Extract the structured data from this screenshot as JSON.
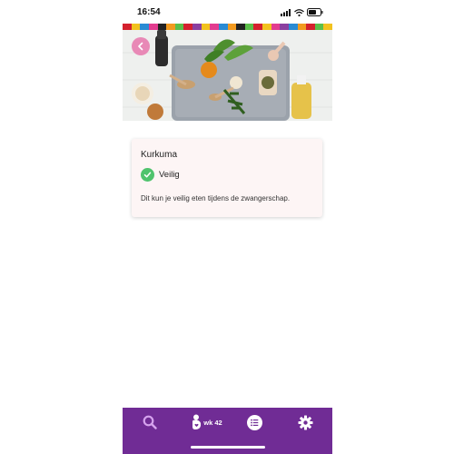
{
  "status_bar": {
    "time": "16:54"
  },
  "colors": {
    "brand_purple": "#702c95",
    "back_button": "#e889b6",
    "safe_green": "#4fc36d",
    "card_background": "#fdf5f5",
    "stripe": [
      "#d4212e",
      "#f2c21f",
      "#2a8bd4",
      "#e23c8f",
      "#222222",
      "#f29a1f",
      "#5bbf4a",
      "#d4212e",
      "#8b3fa0",
      "#f2c21f",
      "#e23c8f",
      "#2a8bd4",
      "#f29a1f",
      "#222222",
      "#5bbf4a",
      "#d4212e",
      "#f2c21f",
      "#e23c8f",
      "#8b3fa0",
      "#2a8bd4",
      "#f29a1f",
      "#d4212e",
      "#5bbf4a",
      "#f2c21f"
    ]
  },
  "hero": {
    "image": "spices-herbs-photo",
    "back_icon": "chevron-left-icon"
  },
  "item": {
    "name": "Kurkuma",
    "status": "Veilig",
    "status_icon": "check-icon",
    "description": "Dit kun je veilig eten tijdens de zwangerschap."
  },
  "tabbar": {
    "search_icon": "search-icon",
    "week_icon": "pregnancy-icon",
    "week_label": "wk 42",
    "list_icon": "list-icon",
    "settings_icon": "gear-icon"
  }
}
